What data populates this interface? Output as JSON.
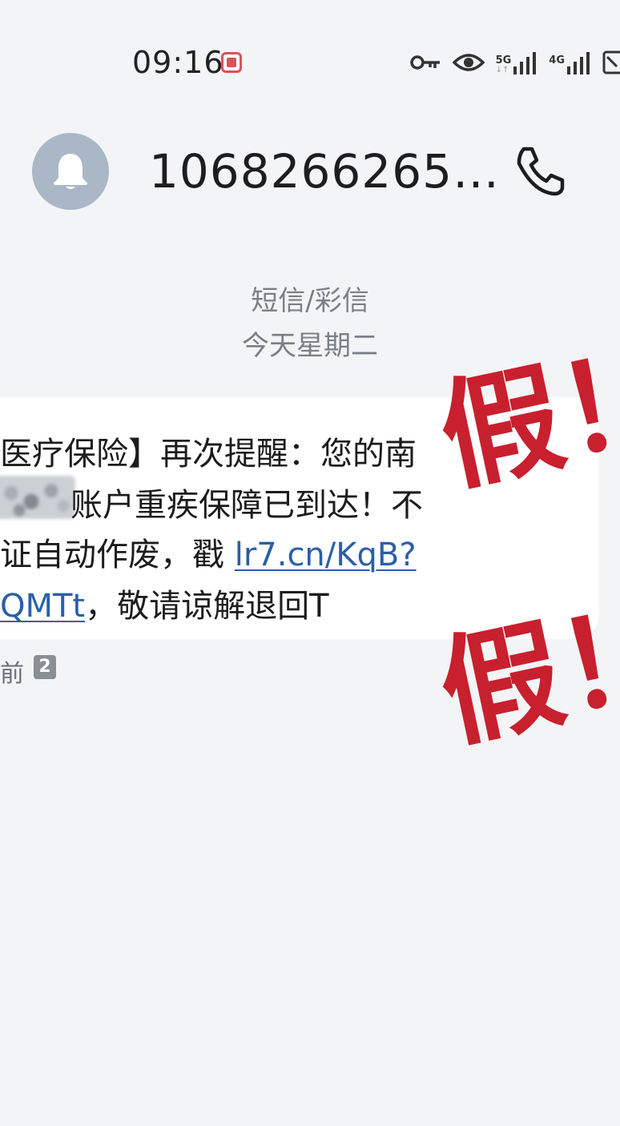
{
  "status_bar": {
    "time": "09:16",
    "network_1": "5G",
    "network_2": "4G",
    "icons": [
      "notification-icon",
      "key-icon",
      "eye-icon",
      "signal-icon",
      "battery-icon"
    ]
  },
  "header": {
    "sender": "1068266265…",
    "avatar_icon": "bell-icon",
    "call_icon": "phone-icon"
  },
  "meta": {
    "message_type": "短信/彩信",
    "date": "今天星期二"
  },
  "message": {
    "line1": "医疗保险】再次提醒：您的南",
    "line2": "账户重疾保障已到达！不",
    "line3_text": "证自动作废，戳 ",
    "line3_link": "lr7.cn/KqB?",
    "line4_link": "QMTt",
    "line4_text": "，敬请谅解退回T",
    "time_suffix": "前",
    "sim_badge": "2"
  },
  "stamps": {
    "text": "假！",
    "color": "#c8202e"
  }
}
